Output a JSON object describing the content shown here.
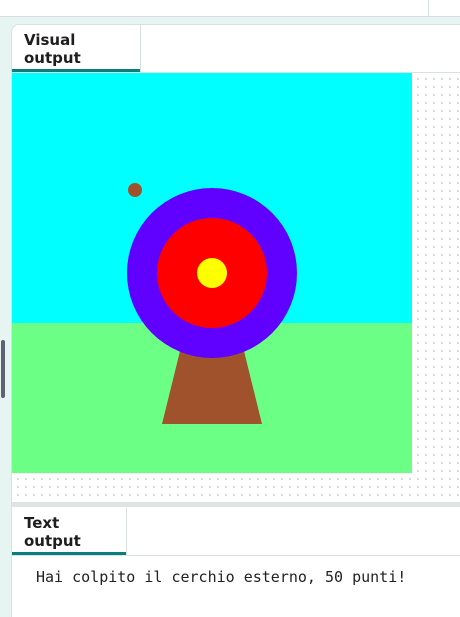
{
  "tabs": {
    "visual_output": "Visual output",
    "text_output": "Text output"
  },
  "console": {
    "lines": [
      "Hai colpito il cerchio esterno, 50 punti!"
    ]
  },
  "scene": {
    "sky_color": "#00ffff",
    "grass_color": "#6cff86",
    "stand_color": "#a0522d",
    "arrow_color": "#a0522d",
    "outer_ring_color": "#6000ff",
    "middle_ring_color": "#ff0000",
    "bullseye_color": "#ffff00"
  },
  "colors": {
    "accent": "#0a7e7a"
  }
}
